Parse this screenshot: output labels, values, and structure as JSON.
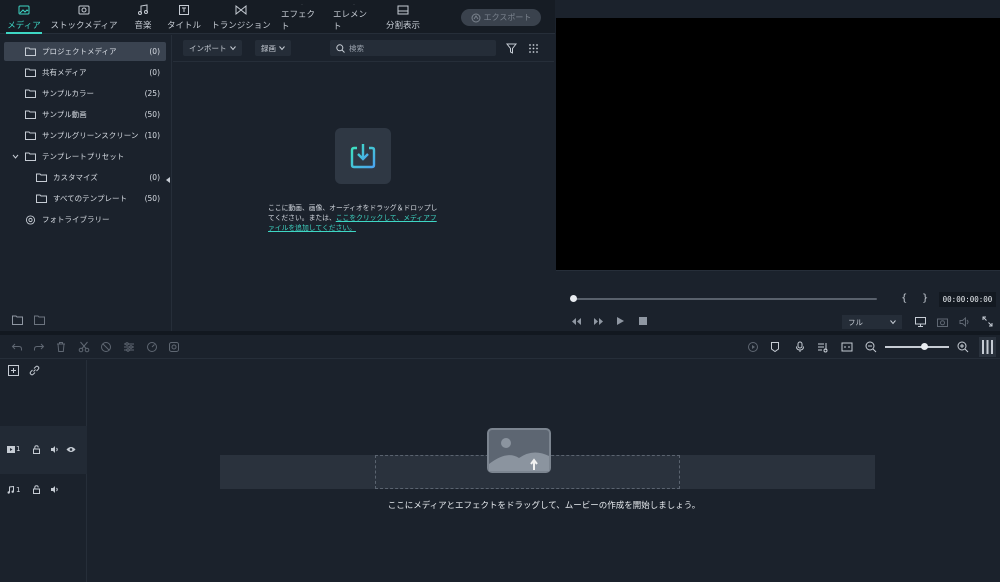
{
  "tabs": [
    {
      "label": "メディア",
      "icon": "media-icon",
      "active": true
    },
    {
      "label": "ストックメディア",
      "icon": "stock-media-icon"
    },
    {
      "label": "音楽",
      "icon": "music-icon"
    },
    {
      "label": "タイトル",
      "icon": "title-icon"
    },
    {
      "label": "トランジション",
      "icon": "transition-icon"
    },
    {
      "label": "エフェクト",
      "icon": "effect-icon"
    },
    {
      "label": "エレメント",
      "icon": "element-icon"
    },
    {
      "label": "分割表示",
      "icon": "split-screen-icon"
    }
  ],
  "export_label": "エクスポート",
  "sidebar": {
    "items": [
      {
        "label": "プロジェクトメディア",
        "count": "(0)"
      },
      {
        "label": "共有メディア",
        "count": "(0)"
      },
      {
        "label": "サンプルカラー",
        "count": "(25)"
      },
      {
        "label": "サンプル動画",
        "count": "(50)"
      },
      {
        "label": "サンプルグリーンスクリーン",
        "count": "(10)"
      },
      {
        "label": "テンプレートプリセット",
        "count": ""
      },
      {
        "label": "カスタマイズ",
        "count": "(0)"
      },
      {
        "label": "すべてのテンプレート",
        "count": "(50)"
      },
      {
        "label": "フォトライブラリー",
        "count": ""
      }
    ]
  },
  "media": {
    "import_label": "インポート",
    "sort_label": "録画",
    "search_placeholder": "検索",
    "drop_text_line1": "ここに動画、画像、オーディオをドラッグ＆ドロップし",
    "drop_text_line2a": "てください。または、",
    "drop_text_link1": "ここをクリックして、メディアフ",
    "drop_text_link2": "ァイルを追加してください。"
  },
  "preview": {
    "timecode": "00:00:00:00",
    "quality": "フル",
    "progress": 0
  },
  "timeline": {
    "video_track_num": "1",
    "audio_track_num": "1",
    "drop_message": "ここにメディアとエフェクトをドラッグして、ムービーの作成を開始しましょう。"
  }
}
